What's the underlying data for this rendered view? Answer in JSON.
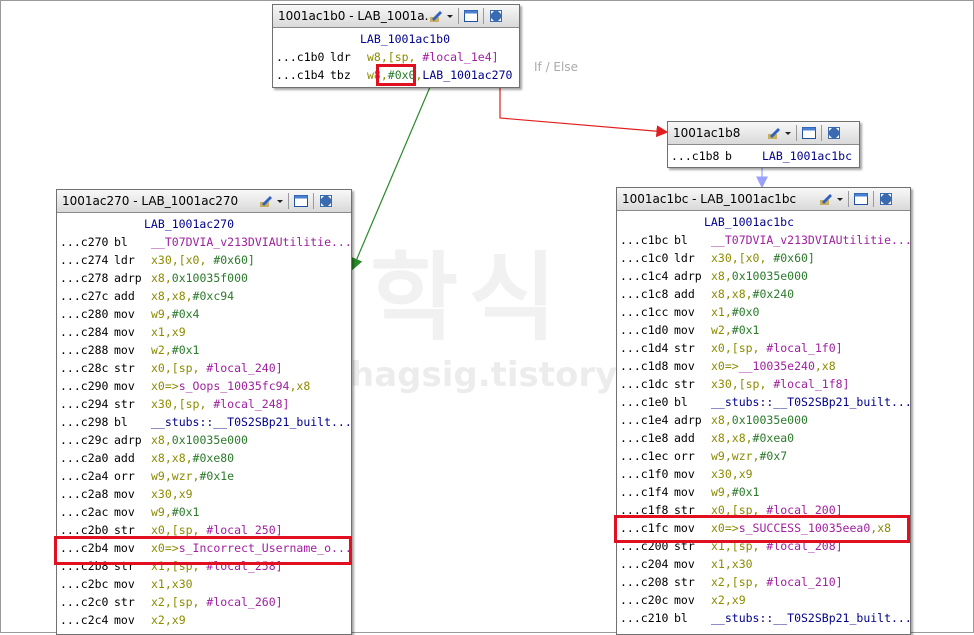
{
  "edge_label": "If / Else",
  "watermark": {
    "big": "학식",
    "small": "hagsig.tistory.com"
  },
  "colors": {
    "highlight": "#e01020",
    "edge_true": "#2a8a2a",
    "edge_false": "#e02020",
    "edge_fallthrough": "#9aa0ff"
  },
  "blocks": {
    "top": {
      "title": "1001ac1b0 - LAB_1001a...",
      "label": "LAB_1001ac1b0",
      "lines": [
        {
          "addr": "...c1b0",
          "mn": "ldr",
          "ops": [
            [
              "w8,[sp, ",
              "op-y"
            ],
            [
              "#local_1e4]",
              "op-m"
            ]
          ]
        },
        {
          "addr": "...c1b4",
          "mn": "tbz",
          "ops": [
            [
              "w8,",
              "op-y"
            ],
            [
              "#0x0",
              "op-g"
            ],
            [
              ",",
              "op-y"
            ],
            [
              "LAB_1001ac270",
              "op-b"
            ]
          ]
        }
      ]
    },
    "mid": {
      "title": "1001ac1b8",
      "lines": [
        {
          "addr": "...c1b8",
          "mn": "b",
          "ops": [
            [
              "LAB_1001ac1bc",
              "op-b"
            ]
          ]
        }
      ]
    },
    "left": {
      "title": "1001ac270 - LAB_1001ac270",
      "label": "LAB_1001ac270",
      "lines": [
        {
          "addr": "...c270",
          "mn": "bl",
          "ops": [
            [
              "__T07DVIA_v213DVIAUtilitie...",
              "op-m"
            ]
          ]
        },
        {
          "addr": "...c274",
          "mn": "ldr",
          "ops": [
            [
              "x30,[x0, ",
              "op-y"
            ],
            [
              "#0x60]",
              "op-g"
            ]
          ]
        },
        {
          "addr": "...c278",
          "mn": "adrp",
          "ops": [
            [
              "x8,",
              "op-y"
            ],
            [
              "0x10035f000",
              "op-g"
            ]
          ]
        },
        {
          "addr": "...c27c",
          "mn": "add",
          "ops": [
            [
              "x8,x8,",
              "op-y"
            ],
            [
              "#0xc94",
              "op-g"
            ]
          ]
        },
        {
          "addr": "...c280",
          "mn": "mov",
          "ops": [
            [
              "w9,",
              "op-y"
            ],
            [
              "#0x4",
              "op-g"
            ]
          ]
        },
        {
          "addr": "...c284",
          "mn": "mov",
          "ops": [
            [
              "x1,x9",
              "op-y"
            ]
          ]
        },
        {
          "addr": "...c288",
          "mn": "mov",
          "ops": [
            [
              "w2,",
              "op-y"
            ],
            [
              "#0x1",
              "op-g"
            ]
          ]
        },
        {
          "addr": "...c28c",
          "mn": "str",
          "ops": [
            [
              "x0,[sp, ",
              "op-y"
            ],
            [
              "#local_240]",
              "op-m"
            ]
          ]
        },
        {
          "addr": "...c290",
          "mn": "mov",
          "ops": [
            [
              "x0=>",
              "op-y"
            ],
            [
              "s_Oops_10035fc94",
              "op-m"
            ],
            [
              ",x8",
              "op-y"
            ]
          ]
        },
        {
          "addr": "...c294",
          "mn": "str",
          "ops": [
            [
              "x30,[sp, ",
              "op-y"
            ],
            [
              "#local_248]",
              "op-m"
            ]
          ]
        },
        {
          "addr": "...c298",
          "mn": "bl",
          "ops": [
            [
              "__stubs::__T0S2SBp21_built...",
              "op-b"
            ]
          ]
        },
        {
          "addr": "...c29c",
          "mn": "adrp",
          "ops": [
            [
              "x8,",
              "op-y"
            ],
            [
              "0x10035e000",
              "op-g"
            ]
          ]
        },
        {
          "addr": "...c2a0",
          "mn": "add",
          "ops": [
            [
              "x8,x8,",
              "op-y"
            ],
            [
              "#0xe80",
              "op-g"
            ]
          ]
        },
        {
          "addr": "...c2a4",
          "mn": "orr",
          "ops": [
            [
              "w9,wzr,",
              "op-y"
            ],
            [
              "#0x1e",
              "op-g"
            ]
          ]
        },
        {
          "addr": "...c2a8",
          "mn": "mov",
          "ops": [
            [
              "x30,x9",
              "op-y"
            ]
          ]
        },
        {
          "addr": "...c2ac",
          "mn": "mov",
          "ops": [
            [
              "w9,",
              "op-y"
            ],
            [
              "#0x1",
              "op-g"
            ]
          ]
        },
        {
          "addr": "...c2b0",
          "mn": "str",
          "ops": [
            [
              "x0,[sp, ",
              "op-y"
            ],
            [
              "#local_250]",
              "op-m"
            ]
          ]
        },
        {
          "addr": "...c2b4",
          "mn": "mov",
          "ops": [
            [
              "x0=>",
              "op-y"
            ],
            [
              "s_Incorrect_Username_o...",
              "op-m"
            ]
          ]
        },
        {
          "addr": "...c2b8",
          "mn": "str",
          "ops": [
            [
              "x1,[sp, ",
              "op-y"
            ],
            [
              "#local_258]",
              "op-m"
            ]
          ]
        },
        {
          "addr": "...c2bc",
          "mn": "mov",
          "ops": [
            [
              "x1,x30",
              "op-y"
            ]
          ]
        },
        {
          "addr": "...c2c0",
          "mn": "str",
          "ops": [
            [
              "x2,[sp, ",
              "op-y"
            ],
            [
              "#local_260]",
              "op-m"
            ]
          ]
        },
        {
          "addr": "...c2c4",
          "mn": "mov",
          "ops": [
            [
              "x2,x9",
              "op-y"
            ]
          ]
        }
      ]
    },
    "right": {
      "title": "1001ac1bc - LAB_1001ac1bc",
      "label": "LAB_1001ac1bc",
      "lines": [
        {
          "addr": "...c1bc",
          "mn": "bl",
          "ops": [
            [
              "__T07DVIA_v213DVIAUtilitie...",
              "op-m"
            ]
          ]
        },
        {
          "addr": "...c1c0",
          "mn": "ldr",
          "ops": [
            [
              "x30,[x0, ",
              "op-y"
            ],
            [
              "#0x60]",
              "op-g"
            ]
          ]
        },
        {
          "addr": "...c1c4",
          "mn": "adrp",
          "ops": [
            [
              "x8,",
              "op-y"
            ],
            [
              "0x10035e000",
              "op-g"
            ]
          ]
        },
        {
          "addr": "...c1c8",
          "mn": "add",
          "ops": [
            [
              "x8,x8,",
              "op-y"
            ],
            [
              "#0x240",
              "op-g"
            ]
          ]
        },
        {
          "addr": "...c1cc",
          "mn": "mov",
          "ops": [
            [
              "x1,",
              "op-y"
            ],
            [
              "#0x0",
              "op-g"
            ]
          ]
        },
        {
          "addr": "...c1d0",
          "mn": "mov",
          "ops": [
            [
              "w2,",
              "op-y"
            ],
            [
              "#0x1",
              "op-g"
            ]
          ]
        },
        {
          "addr": "...c1d4",
          "mn": "str",
          "ops": [
            [
              "x0,[sp, ",
              "op-y"
            ],
            [
              "#local_1f0]",
              "op-m"
            ]
          ]
        },
        {
          "addr": "...c1d8",
          "mn": "mov",
          "ops": [
            [
              "x0=>",
              "op-y"
            ],
            [
              "__10035e240",
              "op-m"
            ],
            [
              ",x8",
              "op-y"
            ]
          ]
        },
        {
          "addr": "...c1dc",
          "mn": "str",
          "ops": [
            [
              "x30,[sp, ",
              "op-y"
            ],
            [
              "#local_1f8]",
              "op-m"
            ]
          ]
        },
        {
          "addr": "...c1e0",
          "mn": "bl",
          "ops": [
            [
              "__stubs::__T0S2SBp21_built...",
              "op-b"
            ]
          ]
        },
        {
          "addr": "...c1e4",
          "mn": "adrp",
          "ops": [
            [
              "x8,",
              "op-y"
            ],
            [
              "0x10035e000",
              "op-g"
            ]
          ]
        },
        {
          "addr": "...c1e8",
          "mn": "add",
          "ops": [
            [
              "x8,x8,",
              "op-y"
            ],
            [
              "#0xea0",
              "op-g"
            ]
          ]
        },
        {
          "addr": "...c1ec",
          "mn": "orr",
          "ops": [
            [
              "w9,wzr,",
              "op-y"
            ],
            [
              "#0x7",
              "op-g"
            ]
          ]
        },
        {
          "addr": "...c1f0",
          "mn": "mov",
          "ops": [
            [
              "x30,x9",
              "op-y"
            ]
          ]
        },
        {
          "addr": "...c1f4",
          "mn": "mov",
          "ops": [
            [
              "w9,",
              "op-y"
            ],
            [
              "#0x1",
              "op-g"
            ]
          ]
        },
        {
          "addr": "...c1f8",
          "mn": "str",
          "ops": [
            [
              "x0,[sp, ",
              "op-y"
            ],
            [
              "#local_200]",
              "op-m"
            ]
          ]
        },
        {
          "addr": "...c1fc",
          "mn": "mov",
          "ops": [
            [
              "x0=>",
              "op-y"
            ],
            [
              "s_SUCCESS_10035eea0",
              "op-m"
            ],
            [
              ",x8",
              "op-y"
            ]
          ]
        },
        {
          "addr": "...c200",
          "mn": "str",
          "ops": [
            [
              "x1,[sp, ",
              "op-y"
            ],
            [
              "#local_208]",
              "op-m"
            ]
          ]
        },
        {
          "addr": "...c204",
          "mn": "mov",
          "ops": [
            [
              "x1,x30",
              "op-y"
            ]
          ]
        },
        {
          "addr": "...c208",
          "mn": "str",
          "ops": [
            [
              "x2,[sp, ",
              "op-y"
            ],
            [
              "#local_210]",
              "op-m"
            ]
          ]
        },
        {
          "addr": "...c20c",
          "mn": "mov",
          "ops": [
            [
              "x2,x9",
              "op-y"
            ]
          ]
        },
        {
          "addr": "...c210",
          "mn": "bl",
          "ops": [
            [
              "__stubs::__T0S2SBp21_built...",
              "op-b"
            ]
          ]
        }
      ]
    }
  }
}
